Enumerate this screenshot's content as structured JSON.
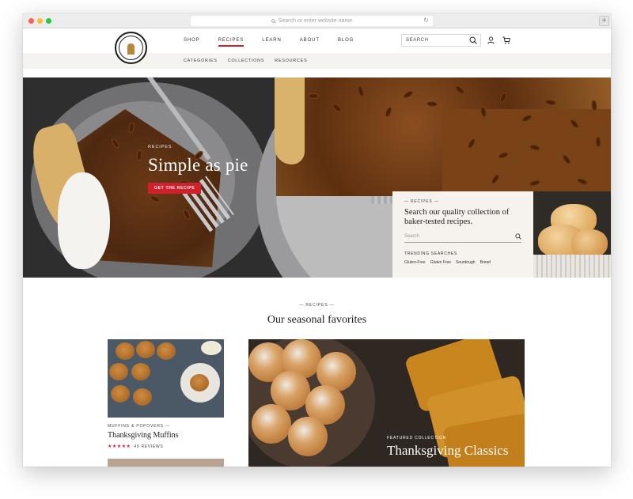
{
  "browser": {
    "url_placeholder": "Search or enter website name",
    "new_tab": "+"
  },
  "header": {
    "nav": [
      "SHOP",
      "RECIPES",
      "LEARN",
      "ABOUT",
      "BLOG"
    ],
    "active_nav": "RECIPES",
    "search_label": "SEARCH"
  },
  "subnav": [
    "CATEGORIES",
    "COLLECTIONS",
    "RESOURCES"
  ],
  "hero": {
    "kicker": "RECIPES",
    "title": "Simple as pie",
    "button": "GET THE RECIPE"
  },
  "search_panel": {
    "kicker": "— RECIPES —",
    "title": "Search our quality collection of baker-tested recipes.",
    "placeholder": "Search",
    "trending_label": "TRENDING SEARCHES",
    "tags": [
      "Gluten-Free",
      "Gluten Free",
      "Sourdough",
      "Bread"
    ]
  },
  "seasonal": {
    "kicker": "— RECIPES —",
    "title": "Our seasonal favorites",
    "card": {
      "kicker": "MUFFINS & POPOVERS —",
      "title": "Thanksgiving Muffins",
      "rating": 5,
      "stars": "★★★★★",
      "reviews": "49 REVIEWS"
    },
    "feature": {
      "kicker": "FEATURED COLLECTION",
      "title": "Thanksgiving Classics"
    }
  },
  "colors": {
    "accent": "#d1202c",
    "panel_bg": "#f6f3ee",
    "subnav_bg": "#f5f3ef"
  }
}
